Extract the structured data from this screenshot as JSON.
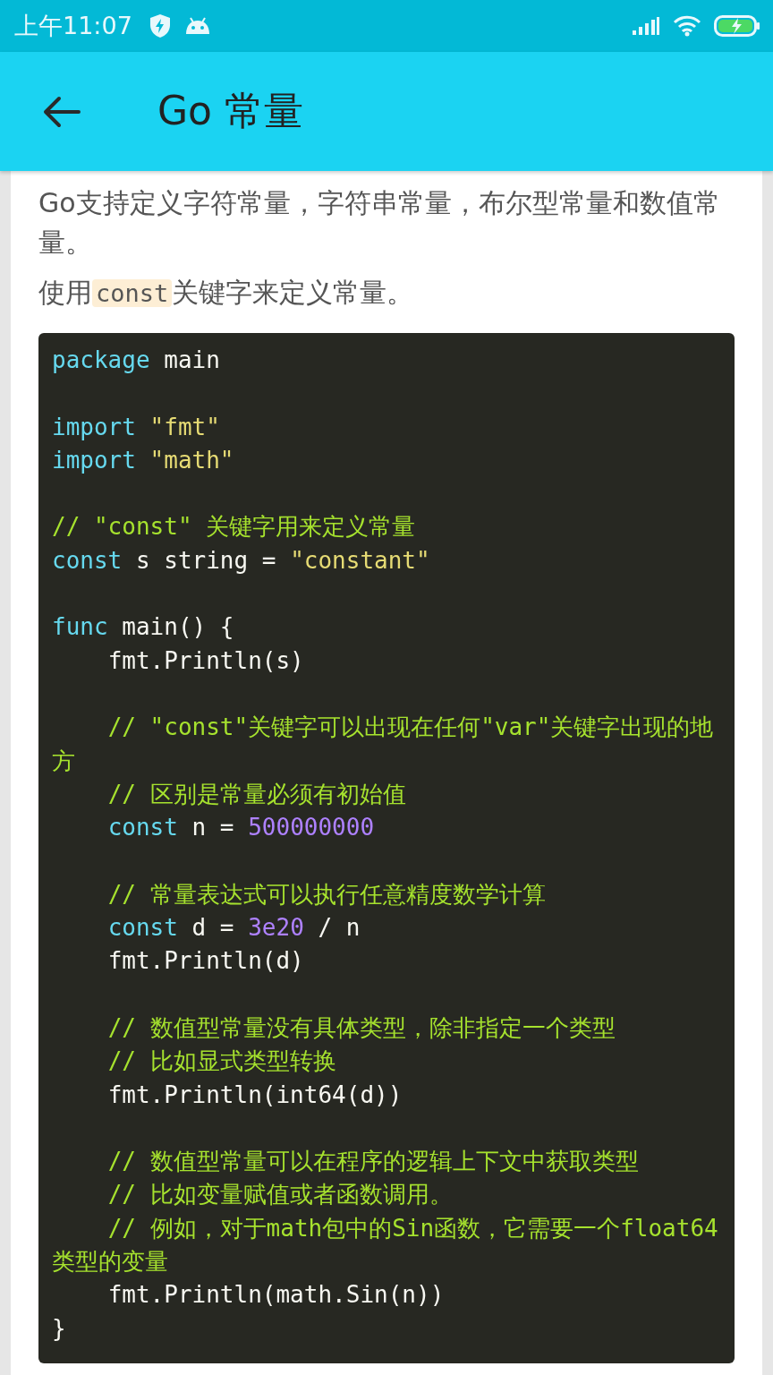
{
  "status_bar": {
    "time": "上午11:07"
  },
  "app_bar": {
    "title": "Go 常量"
  },
  "paragraphs": [
    {
      "parts": [
        {
          "kind": "text",
          "text": "Go支持定义字符常量，字符串常量，布尔型常量和数值常量。"
        }
      ]
    },
    {
      "parts": [
        {
          "kind": "text",
          "text": "使用"
        },
        {
          "kind": "code",
          "text": "const"
        },
        {
          "kind": "text",
          "text": "关键字来定义常量。"
        }
      ]
    }
  ],
  "code_lines": [
    {
      "gap_before": false,
      "indent": false,
      "tokens": [
        {
          "kind": "keyword",
          "text": "package"
        },
        {
          "kind": "plain",
          "text": " main"
        }
      ]
    },
    {
      "gap_before": true,
      "indent": false,
      "tokens": [
        {
          "kind": "keyword",
          "text": "import"
        },
        {
          "kind": "string",
          "text": " \"fmt\""
        }
      ]
    },
    {
      "gap_before": false,
      "indent": false,
      "tokens": [
        {
          "kind": "keyword",
          "text": "import"
        },
        {
          "kind": "string",
          "text": " \"math\""
        }
      ]
    },
    {
      "gap_before": true,
      "indent": false,
      "tokens": [
        {
          "kind": "comment",
          "text": "// \"const\" 关键字用来定义常量"
        }
      ]
    },
    {
      "gap_before": false,
      "indent": false,
      "tokens": [
        {
          "kind": "keyword",
          "text": "const"
        },
        {
          "kind": "plain",
          "text": " s string = "
        },
        {
          "kind": "string",
          "text": "\"constant\""
        }
      ]
    },
    {
      "gap_before": true,
      "indent": false,
      "tokens": [
        {
          "kind": "keyword",
          "text": "func"
        },
        {
          "kind": "plain",
          "text": " main() {"
        }
      ]
    },
    {
      "gap_before": false,
      "indent": true,
      "tokens": [
        {
          "kind": "plain",
          "text": "fmt.Println(s)"
        }
      ]
    },
    {
      "gap_before": true,
      "indent": true,
      "tokens": [
        {
          "kind": "comment",
          "text": "// \"const\"关键字可以出现在任何\"var\"关键字出现的地方"
        }
      ]
    },
    {
      "gap_before": false,
      "indent": true,
      "tokens": [
        {
          "kind": "comment",
          "text": "// 区别是常量必须有初始值"
        }
      ]
    },
    {
      "gap_before": false,
      "indent": true,
      "tokens": [
        {
          "kind": "keyword",
          "text": "const"
        },
        {
          "kind": "plain",
          "text": " n = "
        },
        {
          "kind": "number",
          "text": "500000000"
        }
      ]
    },
    {
      "gap_before": true,
      "indent": true,
      "tokens": [
        {
          "kind": "comment",
          "text": "// 常量表达式可以执行任意精度数学计算"
        }
      ]
    },
    {
      "gap_before": false,
      "indent": true,
      "tokens": [
        {
          "kind": "keyword",
          "text": "const"
        },
        {
          "kind": "plain",
          "text": " d = "
        },
        {
          "kind": "number",
          "text": "3e20"
        },
        {
          "kind": "plain",
          "text": " / n"
        }
      ]
    },
    {
      "gap_before": false,
      "indent": true,
      "tokens": [
        {
          "kind": "plain",
          "text": "fmt.Println(d)"
        }
      ]
    },
    {
      "gap_before": true,
      "indent": true,
      "tokens": [
        {
          "kind": "comment",
          "text": "// 数值型常量没有具体类型，除非指定一个类型"
        }
      ]
    },
    {
      "gap_before": false,
      "indent": true,
      "tokens": [
        {
          "kind": "comment",
          "text": "// 比如显式类型转换"
        }
      ]
    },
    {
      "gap_before": false,
      "indent": true,
      "tokens": [
        {
          "kind": "plain",
          "text": "fmt.Println(int64(d))"
        }
      ]
    },
    {
      "gap_before": true,
      "indent": true,
      "tokens": [
        {
          "kind": "comment",
          "text": "// 数值型常量可以在程序的逻辑上下文中获取类型"
        }
      ]
    },
    {
      "gap_before": false,
      "indent": true,
      "tokens": [
        {
          "kind": "comment",
          "text": "// 比如变量赋值或者函数调用。"
        }
      ]
    },
    {
      "gap_before": false,
      "indent": true,
      "tokens": [
        {
          "kind": "comment",
          "text": "// 例如，对于math包中的Sin函数，它需要一个float64类型的变量"
        }
      ]
    },
    {
      "gap_before": false,
      "indent": true,
      "tokens": [
        {
          "kind": "plain",
          "text": "fmt.Println(math.Sin(n))"
        }
      ]
    },
    {
      "gap_before": false,
      "indent": false,
      "tokens": [
        {
          "kind": "plain",
          "text": "}"
        }
      ]
    }
  ]
}
